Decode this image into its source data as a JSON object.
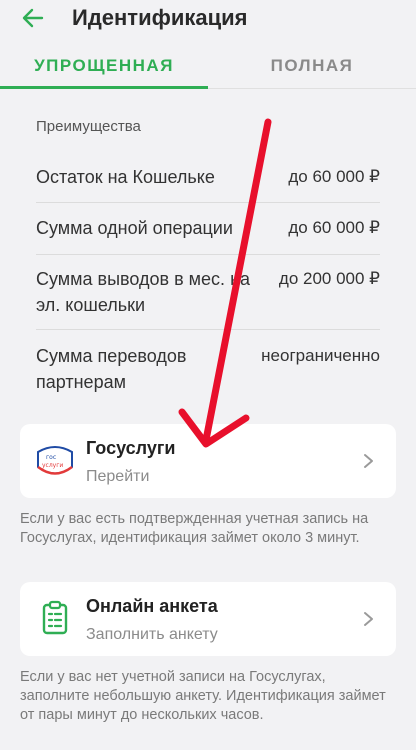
{
  "header": {
    "title": "Идентификация",
    "back_icon": "arrow-left-icon"
  },
  "tabs": [
    {
      "label": "УПРОЩЕННАЯ",
      "active": true
    },
    {
      "label": "ПОЛНАЯ",
      "active": false
    }
  ],
  "benefits": {
    "label": "Преимущества",
    "rows": [
      {
        "label": "Остаток на Кошельке",
        "value": "до 60 000 ₽"
      },
      {
        "label": "Сумма одной операции",
        "value": "до 60 000 ₽"
      },
      {
        "label": "Сумма выводов в мес. на эл. кошельки",
        "value": "до 200 000 ₽"
      },
      {
        "label": "Сумма переводов партнерам",
        "value": "неограниченно"
      }
    ]
  },
  "gosuslugi": {
    "title": "Госуслуги",
    "subtitle": "Перейти",
    "logo_text_1": "гос",
    "logo_text_2": "услуги",
    "note": "Если у вас есть подтвержденная учетная запись на Госуслугах, идентификация займет около 3 минут."
  },
  "online_form": {
    "title": "Онлайн анкета",
    "subtitle": "Заполнить анкету",
    "note": "Если у вас нет учетной записи на Госуслугах, заполните небольшую анкету. Идентификация займет от пары минут до нескольких часов."
  },
  "colors": {
    "accent": "#2fae54",
    "annotation": "#e8102c"
  }
}
